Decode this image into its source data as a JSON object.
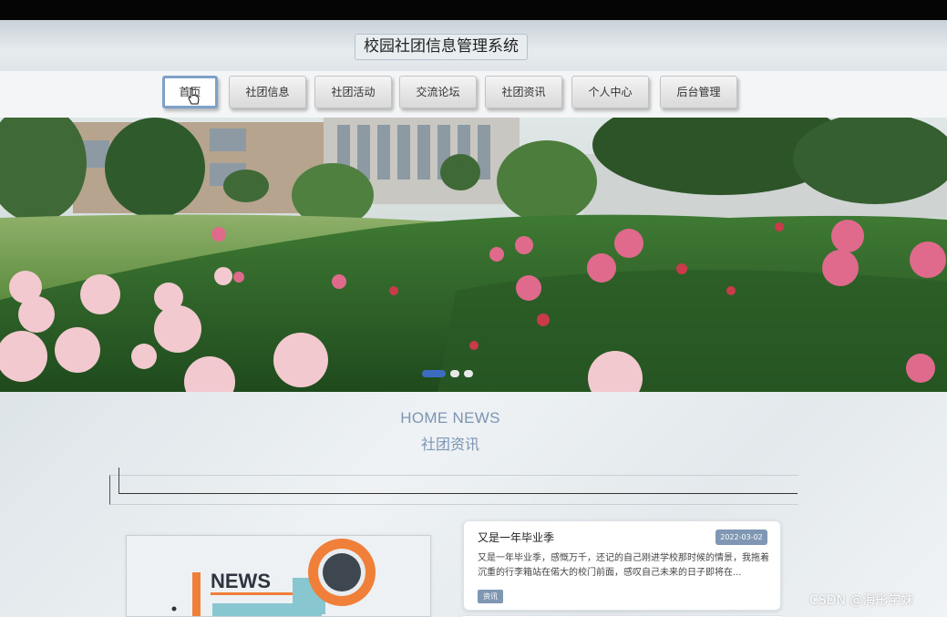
{
  "header": {
    "site_title": "校园社团信息管理系统"
  },
  "nav": {
    "items": [
      {
        "label": "首页",
        "active": true
      },
      {
        "label": "社团信息",
        "active": false
      },
      {
        "label": "社团活动",
        "active": false
      },
      {
        "label": "交流论坛",
        "active": false
      },
      {
        "label": "社团资讯",
        "active": false
      },
      {
        "label": "个人中心",
        "active": false
      },
      {
        "label": "后台管理",
        "active": false
      }
    ]
  },
  "banner": {
    "slides": 3,
    "active_slide": 1
  },
  "news_section": {
    "title_en": "HOME NEWS",
    "title_cn": "社团资讯",
    "image_text": "NEWS",
    "card": {
      "title": "又是一年毕业季",
      "date": "2022-03-02",
      "summary": "又是一年毕业季，感慨万千，还记的自己刚进学校那时候的情景，我拖着沉重的行李箱站在偌大的校门前面，感叹自己未来的日子即将在...",
      "tag": "资讯"
    }
  },
  "watermark": "CSDN @海彤学妹",
  "colors": {
    "accent": "#7f97b3",
    "active_border": "#7fa1c8",
    "dot_active": "#3b6cc0"
  }
}
